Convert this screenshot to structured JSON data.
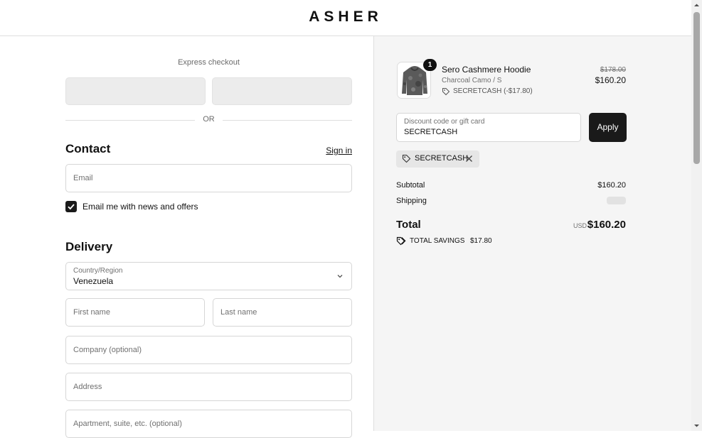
{
  "header": {
    "brand": "ASHER"
  },
  "express": {
    "label": "Express checkout",
    "or": "OR"
  },
  "contact": {
    "title": "Contact",
    "sign_in": "Sign in",
    "email_placeholder": "Email",
    "newsletter_label": "Email me with news and offers",
    "newsletter_checked": true
  },
  "delivery": {
    "title": "Delivery",
    "country_label": "Country/Region",
    "country_value": "Venezuela",
    "first_name": "First name",
    "last_name": "Last name",
    "company": "Company (optional)",
    "address": "Address",
    "apartment": "Apartment, suite, etc. (optional)"
  },
  "summary": {
    "item": {
      "quantity": "1",
      "name": "Sero Cashmere Hoodie",
      "variant": "Charcoal Camo / S",
      "discount": "SECRETCASH (-$17.80)",
      "original_price": "$178.00",
      "price": "$160.20"
    },
    "discount_field": {
      "label": "Discount code or gift card",
      "value": "SECRETCASH"
    },
    "apply_label": "Apply",
    "applied_code": "SECRETCASH",
    "subtotal_label": "Subtotal",
    "subtotal_value": "$160.20",
    "shipping_label": "Shipping",
    "total_label": "Total",
    "total_currency": "USD",
    "total_value": "$160.20",
    "savings_label": "TOTAL SAVINGS",
    "savings_value": "$17.80"
  },
  "colors": {
    "accent": "#1a1a1a",
    "panel": "#f5f5f5",
    "border": "#d6d6d6"
  }
}
